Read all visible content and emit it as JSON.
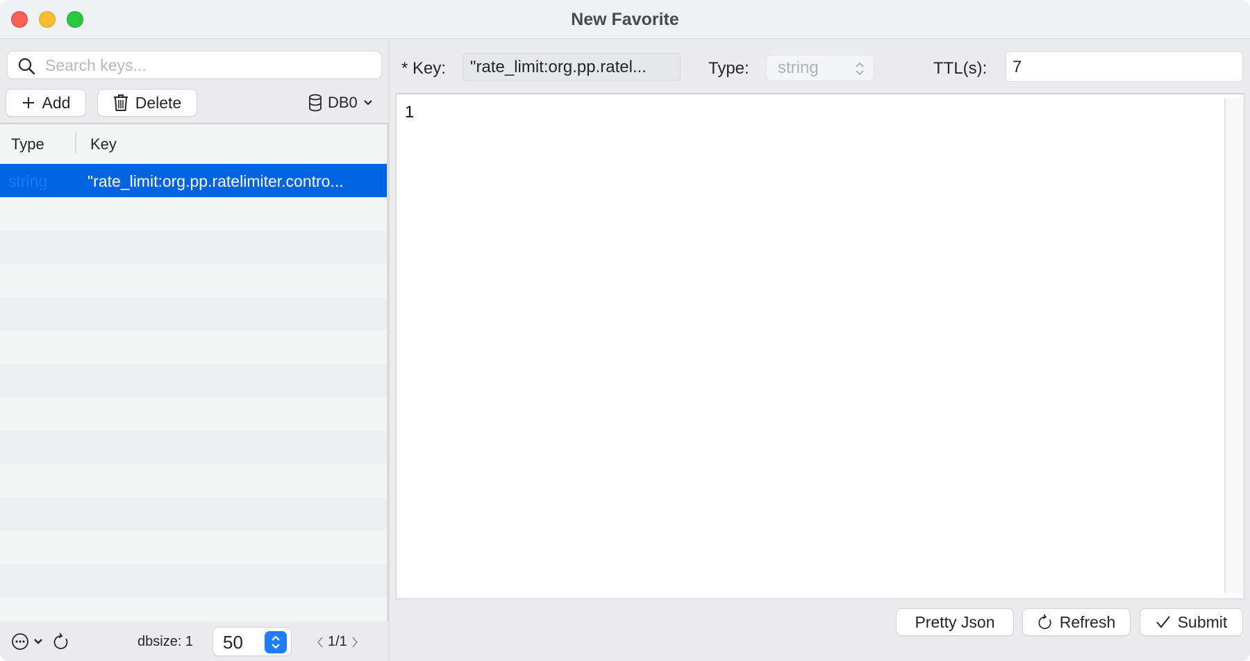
{
  "window": {
    "title": "New Favorite",
    "controls": [
      "close",
      "minimize",
      "maximize"
    ]
  },
  "sidebar": {
    "search": {
      "placeholder": "Search keys...",
      "value": "",
      "icon": "search-icon"
    },
    "toolbar": {
      "add_label": "Add",
      "add_icon": "plus-icon",
      "delete_label": "Delete",
      "delete_icon": "trash-icon",
      "db_label": "DB0",
      "db_icon": "database-icon"
    },
    "table": {
      "columns": [
        "Type",
        "Key"
      ],
      "rows": [
        {
          "type": "string",
          "key": "\"rate_limit:org.pp.ratelimiter.contro...",
          "selected": true
        }
      ]
    },
    "footer": {
      "dbsize_label": "dbsize: 1",
      "page_size": "50",
      "page": "1/1"
    }
  },
  "editor": {
    "key_label": "* Key:",
    "key_value": "\"rate_limit:org.pp.ratel...",
    "type_label": "Type:",
    "type_value": "string",
    "ttl_label": "TTL(s):",
    "ttl_value": "7",
    "content": "1",
    "buttons": {
      "pretty_json": "Pretty Json",
      "refresh": "Refresh",
      "submit": "Submit"
    }
  },
  "colors": {
    "accent": "#0064e1",
    "stepper": "#1f7dfa",
    "close": "#fe5f57",
    "minimize": "#febc2e",
    "maximize": "#28c840"
  }
}
